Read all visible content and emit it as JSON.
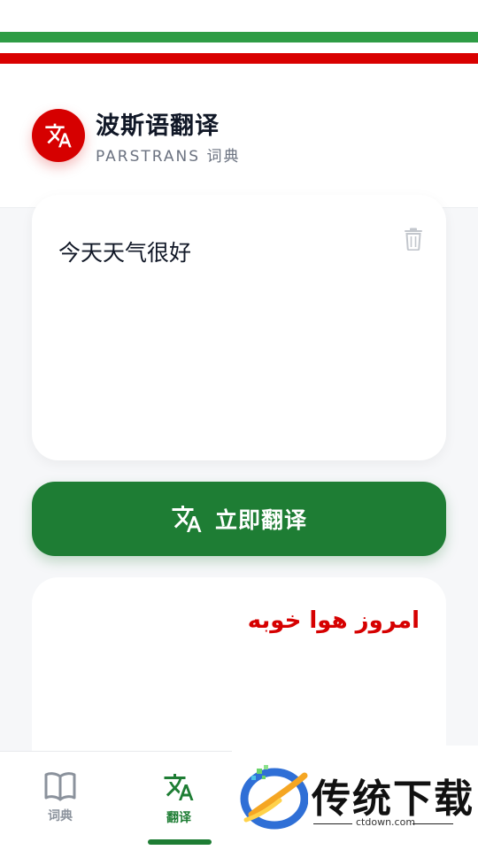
{
  "colors": {
    "flag_green": "#2e9c45",
    "flag_red": "#d90000",
    "brand_red": "#d60000",
    "primary_green": "#1e7d34",
    "muted_gray": "#8b929c"
  },
  "header": {
    "title": "波斯语翻译",
    "subtitle": "PARSTRANS 词典",
    "logo_icon": "translate-icon"
  },
  "input": {
    "text": "今天天气很好",
    "clear_icon": "trash-icon"
  },
  "translate_button": {
    "label": "立即翻译",
    "icon": "translate-icon"
  },
  "output": {
    "text": "امروز هوا خوبه"
  },
  "bottom_nav": {
    "items": [
      {
        "label": "词典",
        "icon": "book-icon",
        "active": false
      },
      {
        "label": "翻译",
        "icon": "translate-icon",
        "active": true
      }
    ]
  },
  "watermark": {
    "text": "传统下载",
    "domain": "ctdown.com"
  }
}
